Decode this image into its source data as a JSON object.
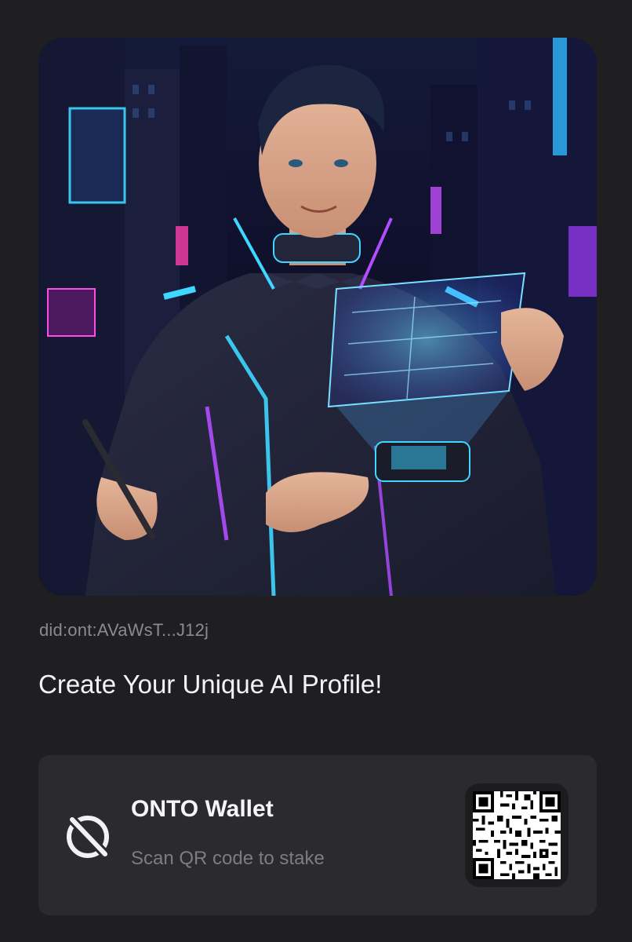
{
  "profile": {
    "did": "did:ont:AVaWsT...J12j",
    "headline": "Create Your Unique AI Profile!"
  },
  "wallet": {
    "name": "ONTO Wallet",
    "subtitle": "Scan QR code to stake",
    "logo_icon": "onto-logo-icon",
    "qr_icon": "qr-code-icon"
  },
  "colors": {
    "background": "#1f1f22",
    "card": "#2b2b2f",
    "text_primary": "#f4f4f6",
    "text_secondary": "#8a8a90",
    "neon_cyan": "#3fd7ff",
    "neon_purple": "#b14dff"
  }
}
